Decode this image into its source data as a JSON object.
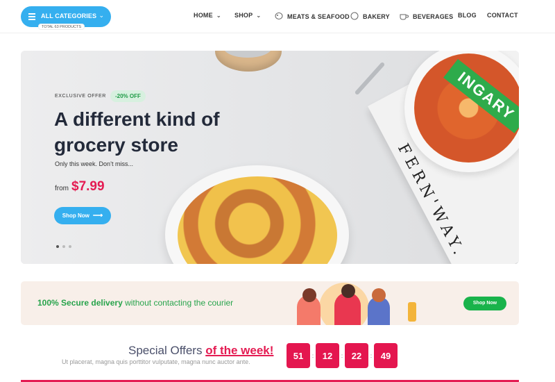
{
  "categories": {
    "label": "ALL CATEGORIES",
    "badge": "TOTAL 63 PRODUCTS"
  },
  "nav": {
    "home": "HOME",
    "shop": "SHOP",
    "meats": "MEATS & SEAFOOD",
    "bakery": "BAKERY",
    "beverages": "BEVERAGES",
    "blog": "BLOG",
    "contact": "CONTACT"
  },
  "hero": {
    "offer_label": "EXCLUSIVE OFFER",
    "offer_badge": "-20% OFF",
    "title": "A different kind of grocery store",
    "subtitle": "Only this week. Don’t miss...",
    "price_from": "from",
    "price": "$7.99",
    "button": "Shop Now",
    "book_brand": "FERN'WAY.",
    "ribbon": "INGARY",
    "slides": 3,
    "active_slide": 1
  },
  "delivery": {
    "strong": "100% Secure delivery",
    "rest": " without contacting the courier",
    "button": "Shop Now"
  },
  "special": {
    "title_a": "Special Offers ",
    "title_b": "of the week!",
    "subtitle": "Ut placerat, magna quis porttitor vulputate, magna nunc auctor ante.",
    "countdown": [
      "51",
      "12",
      "22",
      "49"
    ]
  },
  "colors": {
    "accent_blue": "#35afef",
    "accent_red": "#e41b52",
    "accent_green": "#19b34b"
  }
}
